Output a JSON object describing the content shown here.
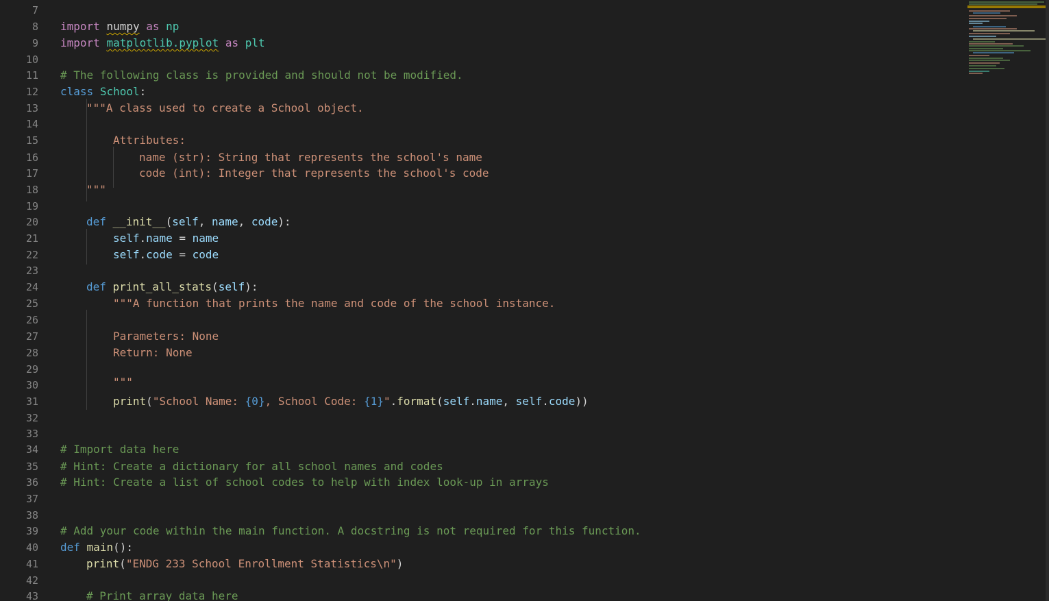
{
  "editor": {
    "colors": {
      "background": "#1f1f1f",
      "line_number": "#858585",
      "keyword": "#569cd6",
      "import_keyword": "#c586c0",
      "class_name": "#4ec9b0",
      "function": "#dcdcaa",
      "variable": "#9cdcfe",
      "string": "#ce9178",
      "comment": "#6a9955",
      "warning_squiggle": "#cca700"
    },
    "line_numbers": [
      "7",
      "8",
      "9",
      "10",
      "11",
      "12",
      "13",
      "14",
      "15",
      "16",
      "17",
      "18",
      "19",
      "20",
      "21",
      "22",
      "23",
      "24",
      "25",
      "26",
      "27",
      "28",
      "29",
      "30",
      "31",
      "32",
      "33",
      "34",
      "35",
      "36",
      "37",
      "38",
      "39",
      "40",
      "41",
      "42",
      "43"
    ],
    "lines": {
      "l8": [
        "import",
        "numpy",
        "as",
        "np"
      ],
      "l9": [
        "import",
        "matplotlib.pyplot",
        "as",
        "plt"
      ],
      "l11": "# The following class is provided and should not be modified.",
      "l12": [
        "class",
        "School",
        ":"
      ],
      "l13": "\"\"\"A class used to create a School object.",
      "l15": "Attributes:",
      "l16": "name (str): String that represents the school's name",
      "l17": "code (int): Integer that represents the school's code",
      "l18": "\"\"\"",
      "l20": [
        "def",
        "__init__",
        "(",
        "self",
        ", ",
        "name",
        ", ",
        "code",
        "):"
      ],
      "l21": [
        "self",
        ".",
        "name",
        " = ",
        "name"
      ],
      "l22": [
        "self",
        ".",
        "code",
        " = ",
        "code"
      ],
      "l24": [
        "def",
        "print_all_stats",
        "(",
        "self",
        "):"
      ],
      "l25": "\"\"\"A function that prints the name and code of the school instance.",
      "l27": "Parameters: None",
      "l28": "Return: None",
      "l30": "\"\"\"",
      "l31": [
        "print",
        "(",
        "\"School Name: ",
        "{0}",
        ", School Code: ",
        "{1}",
        "\"",
        ".",
        "format",
        "(",
        "self",
        ".",
        "name",
        ", ",
        "self",
        ".",
        "code",
        "))"
      ],
      "l34": "# Import data here",
      "l35": "# Hint: Create a dictionary for all school names and codes",
      "l36": "# Hint: Create a list of school codes to help with index look-up in arrays",
      "l39": "# Add your code within the main function. A docstring is not required for this function.",
      "l40": [
        "def",
        "main",
        "():"
      ],
      "l41": [
        "print",
        "(",
        "\"ENDG 233 School Enrollment Statistics\\n\"",
        ")"
      ],
      "l43": "# Print array data here"
    }
  }
}
